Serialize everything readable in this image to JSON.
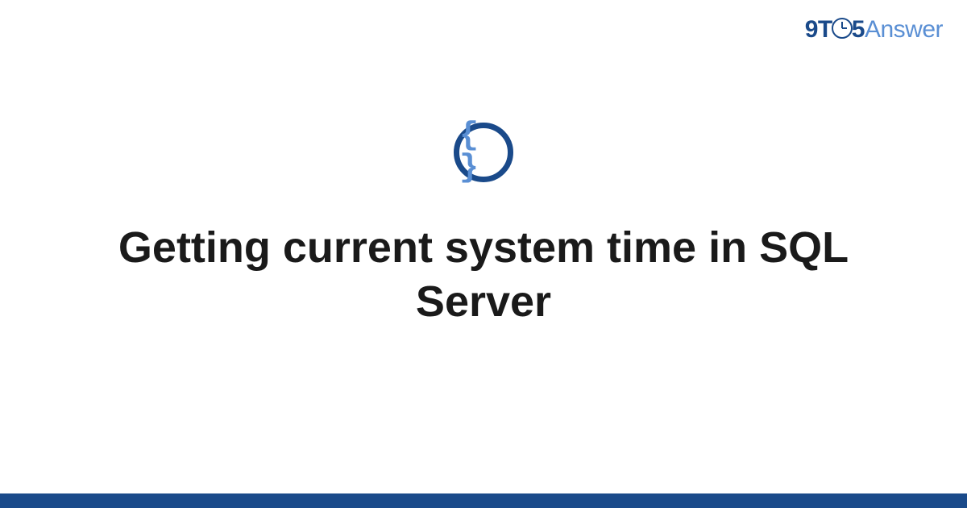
{
  "logo": {
    "part1": "9T",
    "part2": "5",
    "part3": "Answer"
  },
  "icon": {
    "braces": "{ }"
  },
  "title": "Getting current system time in SQL Server",
  "colors": {
    "primary": "#1a4a8a",
    "secondary": "#5a8fd4"
  }
}
